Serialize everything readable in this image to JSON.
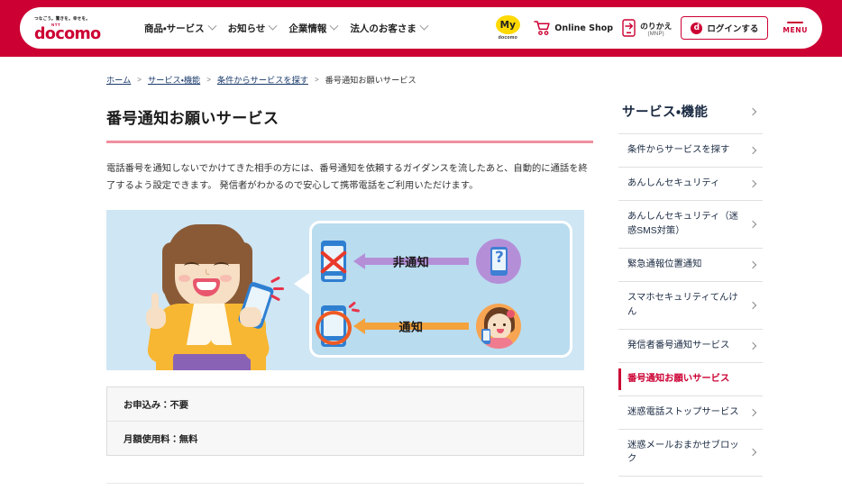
{
  "header": {
    "logo": {
      "tagline": "つなごう。驚きを。幸せを。",
      "ntt": "NTT",
      "brand": "docomo"
    },
    "nav": [
      {
        "label": "商品・サービス"
      },
      {
        "label": "お知らせ"
      },
      {
        "label": "企業情報"
      },
      {
        "label": "法人のお客さま"
      }
    ],
    "my_docomo": {
      "main": "My",
      "sub": "docomo"
    },
    "online_shop": {
      "label": "Online Shop"
    },
    "mnp": {
      "main": "のりかえ",
      "sub": "(MNP)"
    },
    "login": {
      "mark": "d",
      "label": "ログインする"
    },
    "menu": {
      "label": "MENU"
    }
  },
  "breadcrumb": {
    "items": [
      {
        "label": "ホーム",
        "link": true
      },
      {
        "label": "サービス・機能",
        "link": true
      },
      {
        "label": "条件からサービスを探す",
        "link": true
      },
      {
        "label": "番号通知お願いサービス",
        "link": false
      }
    ],
    "separator": "＞"
  },
  "main": {
    "title": "番号通知お願いサービス",
    "description": "電話番号を通知しないでかけてきた相手の方には、番号通知を依頼するガイダンスを流したあと、自動的に通話を終了するよう設定できます。 発信者がわかるので安心して携帯電話をご利用いただけます。",
    "illustration": {
      "alt": "番号通知お願いサービスのイメージ図",
      "unknown_label": "非通知",
      "known_label": "通知",
      "unknown_caller_mark": "?",
      "background_color": "#cfe6f4",
      "unknown_arrow_color": "#b48fd8",
      "known_arrow_color": "#f3a23c"
    },
    "info_rows": [
      {
        "label": "お申込み：不要"
      },
      {
        "label": "月額使用料：無料"
      }
    ]
  },
  "sidebar": {
    "heading": "サービス・機能",
    "items": [
      {
        "label": "条件からサービスを探す",
        "active": false
      },
      {
        "label": "あんしんセキュリティ",
        "active": false
      },
      {
        "label": "あんしんセキュリティ（迷惑SMS対策）",
        "active": false
      },
      {
        "label": "緊急通報位置通知",
        "active": false
      },
      {
        "label": "スマホセキュリティてんけん",
        "active": false
      },
      {
        "label": "発信者番号通知サービス",
        "active": false
      },
      {
        "label": "番号通知お願いサービス",
        "active": true
      },
      {
        "label": "迷惑電話ストップサービス",
        "active": false
      },
      {
        "label": "迷惑メールおまかせブロック",
        "active": false
      }
    ]
  },
  "colors": {
    "brand_red": "#cc0033",
    "title_rule": "#f0909f",
    "my_docomo_yellow": "#ffd900",
    "sidebar_text": "#1a2a42"
  }
}
